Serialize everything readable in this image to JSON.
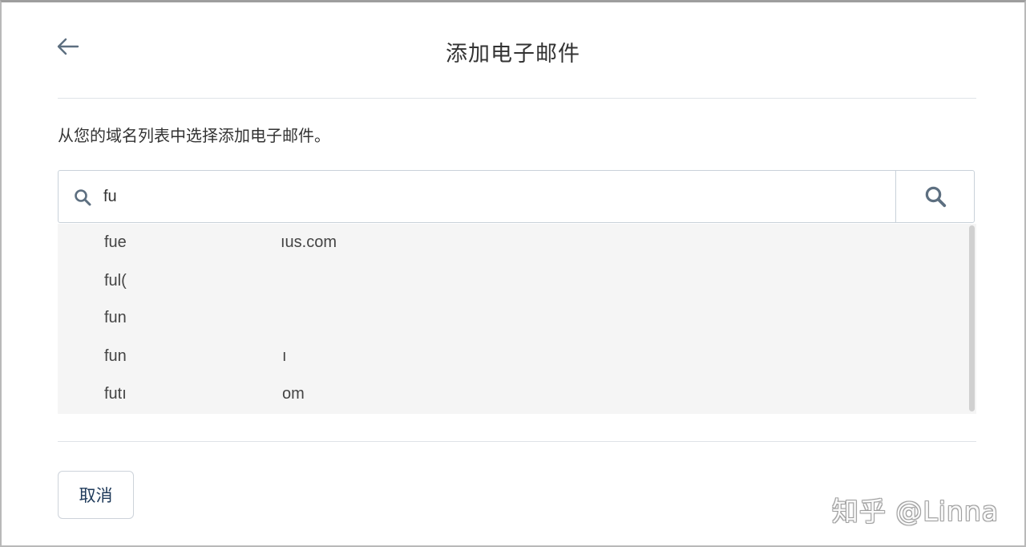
{
  "dialog": {
    "title": "添加电子邮件",
    "subtitle": "从您的域名列表中选择添加电子邮件。"
  },
  "search": {
    "value": "fu",
    "placeholder": ""
  },
  "dropdown": {
    "items": [
      {
        "prefix": "fue",
        "suffix": "ıus.com"
      },
      {
        "prefix": "ful(",
        "suffix": ""
      },
      {
        "prefix": "fun",
        "suffix": ""
      },
      {
        "prefix": "fun",
        "suffix": "ı"
      },
      {
        "prefix": "futı",
        "suffix": "om"
      }
    ]
  },
  "footer": {
    "cancel_label": "取消"
  },
  "watermark": "知乎 @Linna",
  "colors": {
    "icon": "#5d6f80",
    "cancel_text": "#1f3a5a",
    "dropdown_bg": "#f5f5f5",
    "divider": "#dfe3e8"
  },
  "icons": {
    "back": "arrow-left-icon",
    "search_left": "search-icon",
    "search_submit": "search-icon"
  }
}
